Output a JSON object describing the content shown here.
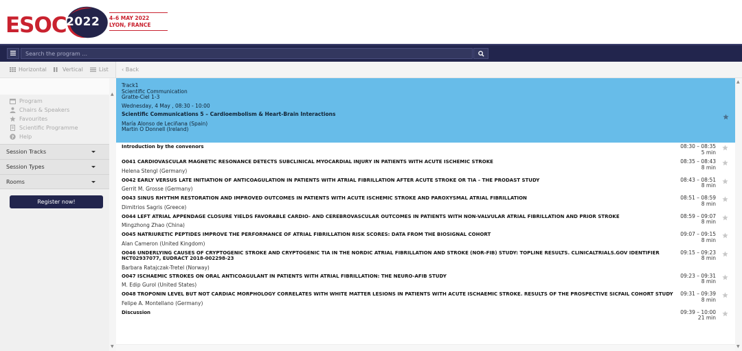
{
  "header": {
    "logo_text": "ESOC",
    "logo_year": "2022",
    "event_dates": "4–6 MAY 2022",
    "event_location": "LYON, FRANCE"
  },
  "navbar": {
    "search_placeholder": "Search the program ..."
  },
  "sidebar": {
    "views": [
      {
        "label": "Horizontal",
        "icon": "grid-icon"
      },
      {
        "label": "Vertical",
        "icon": "columns-icon"
      },
      {
        "label": "List",
        "icon": "list-icon"
      }
    ],
    "links": [
      {
        "label": "Program",
        "icon": "calendar-icon"
      },
      {
        "label": "Chairs & Speakers",
        "icon": "users-icon"
      },
      {
        "label": "Favourites",
        "icon": "star-icon"
      },
      {
        "label": "Scientific Programme",
        "icon": "document-icon"
      },
      {
        "label": "Help",
        "icon": "help-icon"
      }
    ],
    "accordions": [
      "Session Tracks",
      "Session Types",
      "Rooms"
    ],
    "register_label": "Register now!"
  },
  "main": {
    "back_label": "Back",
    "session": {
      "track": "Track1",
      "type": "Scientific Communication",
      "room": "Gratte-Ciel 1-3",
      "datetime": "Wednesday, 4 May , 08:30 - 10:00",
      "title": "Scientific Communications 5 – Cardioembolism & Heart-Brain Interactions",
      "chairs": [
        "María Alonso de Leciñana (Spain)",
        "Martin O Donnell (Ireland)"
      ]
    },
    "items": [
      {
        "title": "Introduction by the convenors",
        "author": "",
        "time": "08:30 – 08:35",
        "duration": "5 min"
      },
      {
        "title": "O041 CARDIOVASCULAR MAGNETIC RESONANCE DETECTS SUBCLINICAL MYOCARDIAL INJURY IN PATIENTS WITH ACUTE ISCHEMIC STROKE",
        "author": "Helena Stengl (Germany)",
        "time": "08:35 – 08:43",
        "duration": "8 min"
      },
      {
        "title": "O042 EARLY VERSUS LATE INITIATION OF ANTICOAGULATION IN PATIENTS WITH ATRIAL FIBRILLATION AFTER ACUTE STROKE OR TIA – THE PRODAST STUDY",
        "author": "Gerrit M. Grosse (Germany)",
        "time": "08:43 – 08:51",
        "duration": "8 min"
      },
      {
        "title": "O043 SINUS RHYTHM RESTORATION AND IMPROVED OUTCOMES IN PATIENTS WITH ACUTE ISCHEMIC STROKE AND PAROXYSMAL ATRIAL FIBRILLATION",
        "author": "Dimitrios Sagris (Greece)",
        "time": "08:51 – 08:59",
        "duration": "8 min"
      },
      {
        "title": "O044 LEFT ATRIAL APPENDAGE CLOSURE YIELDS FAVORABLE CARDIO- AND CEREBROVASCULAR OUTCOMES IN PATIENTS WITH NON-VALVULAR ATRIAL FIBRILLATION AND PRIOR STROKE",
        "author": "Mingzhong Zhao (China)",
        "time": "08:59 – 09:07",
        "duration": "8 min"
      },
      {
        "title": "O045 NATRIURETIC PEPTIDES IMPROVE THE PERFORMANCE OF ATRIAL FIBRILLATION RISK SCORES: DATA FROM THE BIOSIGNAL COHORT",
        "author": "Alan Cameron (United Kingdom)",
        "time": "09:07 – 09:15",
        "duration": "8 min"
      },
      {
        "title": "O046 UNDERLYING CAUSES OF CRYPTOGENIC STROKE AND CRYPTOGENIC TIA IN THE NORDIC ATRIAL FIBRILLATION AND STROKE (NOR-FIB) STUDY: TOPLINE RESULTS. CLINICALTRIALS.GOV IDENTIFIER NCT02937077, EUDRACT 2018-002298-23",
        "author": "Barbara Ratajczak-Tretel (Norway)",
        "time": "09:15 – 09:23",
        "duration": "8 min"
      },
      {
        "title": "O047 ISCHAEMIC STROKES ON ORAL ANTICOAGULANT IN PATIENTS WITH ATRIAL FIBRILLATION: THE NEURO-AFIB STUDY",
        "author": "M. Edip Gurol (United States)",
        "time": "09:23 – 09:31",
        "duration": "8 min"
      },
      {
        "title": "O048 TROPONIN LEVEL BUT NOT CARDIAC MORPHOLOGY CORRELATES WITH WHITE MATTER LESIONS IN PATIENTS WITH ACUTE ISCHAEMIC STROKE. RESULTS OF THE PROSPECTIVE SICFAIL COHORT STUDY",
        "author": "Felipe A. Montellano (Germany)",
        "time": "09:31 – 09:39",
        "duration": "8 min"
      },
      {
        "title": "Discussion",
        "author": "",
        "time": "09:39 – 10:00",
        "duration": "21 min"
      }
    ]
  },
  "colors": {
    "brand_red": "#c9222f",
    "navbar": "#22254d",
    "session_highlight": "#67bce9"
  }
}
